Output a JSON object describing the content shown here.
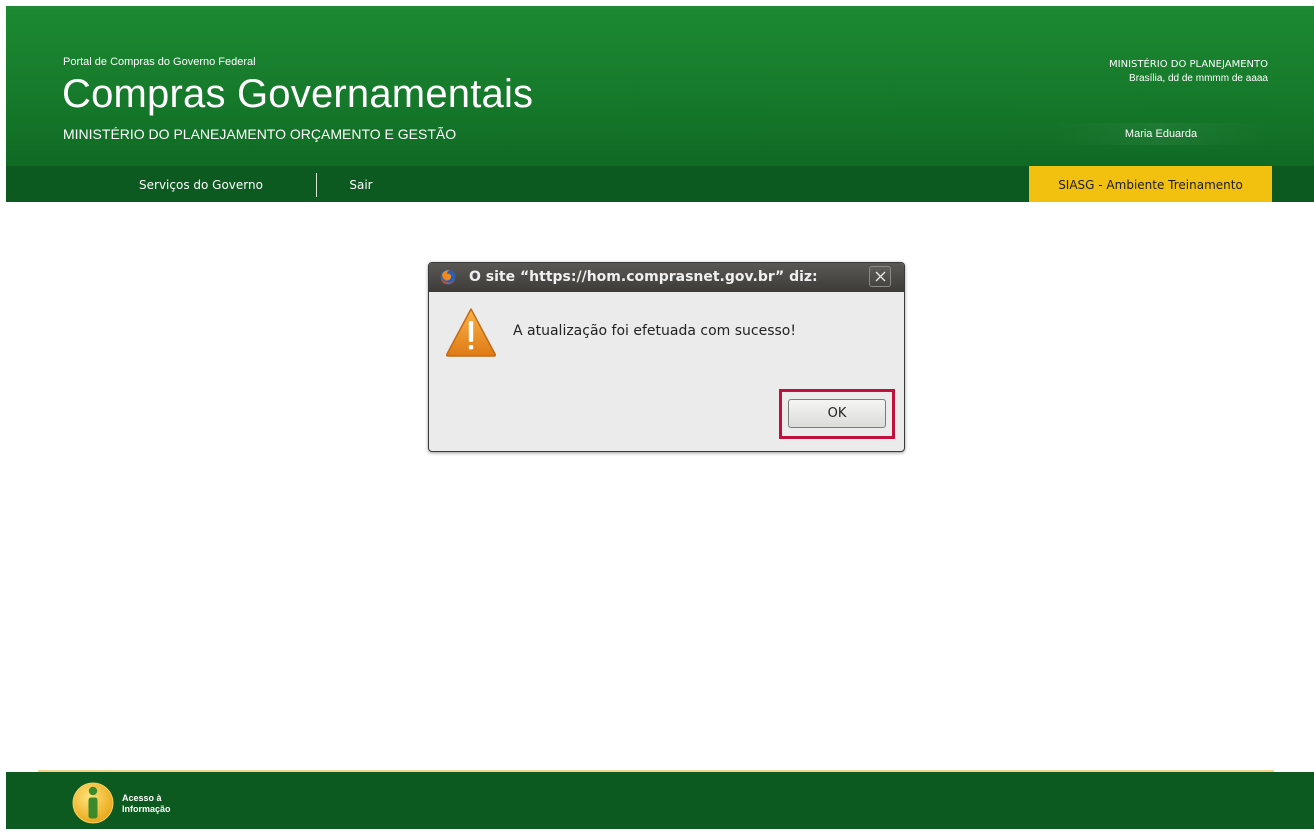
{
  "header": {
    "portal_label": "Portal de Compras do Governo Federal",
    "title": "Compras Governamentais",
    "ministry": "MINISTÉRIO DO PLANEJAMENTO ORÇAMENTO E GESTÃO",
    "ministry_right": "MINISTÉRIO DO PLANEJAMENTO",
    "date_line": "Brasília, dd de mmmm de aaaa",
    "user_name": "Maria Eduarda"
  },
  "nav": {
    "items": [
      {
        "label": "Serviços do Governo"
      },
      {
        "label": "Sair"
      }
    ],
    "environment": "SIASG - Ambiente Treinamento"
  },
  "dialog": {
    "title": "O site “https://hom.comprasnet.gov.br” diz:",
    "message": "A atualização foi efetuada com sucesso!",
    "ok_label": "OK",
    "icon": "warning-icon",
    "titlebar_icon": "firefox-icon",
    "highlight_color": "#c0103e"
  },
  "footer": {
    "access_label": "Acesso à Informação",
    "access_icon": "info-icon"
  },
  "colors": {
    "header_green": "#167a2b",
    "nav_green": "#0c5a1f",
    "env_badge": "#f2c00e"
  }
}
